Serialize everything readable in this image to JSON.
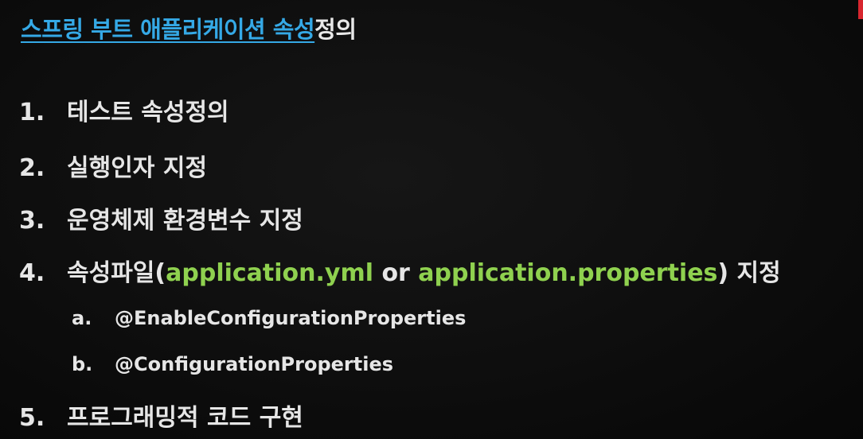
{
  "title": {
    "linked_part": "스프링 부트 애플리케이션 속성",
    "rest": "정의"
  },
  "items": [
    {
      "number": "1.",
      "text": "테스트 속성정의"
    },
    {
      "number": "2.",
      "text": "실행인자 지정"
    },
    {
      "number": "3.",
      "text": "운영체제 환경변수 지정"
    },
    {
      "number": "4.",
      "prefix": "속성파일(",
      "code1": "application.yml",
      "middle": " or ",
      "code2": "application.properties",
      "suffix": ") 지정"
    },
    {
      "number": "5.",
      "text": "프로그래밍적 코드 구현"
    }
  ],
  "subitems": [
    {
      "letter": "a.",
      "text": "@EnableConfigurationProperties"
    },
    {
      "letter": "b.",
      "text": "@ConfigurationProperties"
    }
  ],
  "colors": {
    "title_link": "#35a9e6",
    "code": "#8fd14f",
    "marker": "#d8262f"
  }
}
